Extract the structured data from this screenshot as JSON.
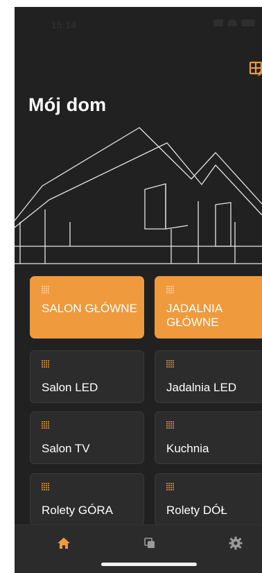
{
  "status_bar": {
    "time": "15:14"
  },
  "header": {
    "title": "Mój dom",
    "action_icon": "grid-edit-icon"
  },
  "colors": {
    "accent": "#ef9a3d",
    "background": "#212121",
    "tile": "#2c2c2c"
  },
  "tiles": [
    {
      "label": "SALON GŁÓWNE",
      "active": true,
      "icon": "light-dots-icon"
    },
    {
      "label": "JADALNIA GŁÓWNE",
      "active": true,
      "icon": "light-dots-icon"
    },
    {
      "label": "Salon LED",
      "active": false,
      "icon": "light-dots-icon"
    },
    {
      "label": "Jadalnia LED",
      "active": false,
      "icon": "light-dots-icon"
    },
    {
      "label": "Salon TV",
      "active": false,
      "icon": "light-dots-icon"
    },
    {
      "label": "Kuchnia",
      "active": false,
      "icon": "light-dots-icon"
    },
    {
      "label": "Rolety GÓRA",
      "active": false,
      "icon": "light-dots-icon"
    },
    {
      "label": "Rolety DÓŁ",
      "active": false,
      "icon": "light-dots-icon"
    }
  ],
  "tabbar": {
    "items": [
      "home-icon",
      "pages-icon",
      "gear-icon"
    ],
    "active_index": 0
  }
}
